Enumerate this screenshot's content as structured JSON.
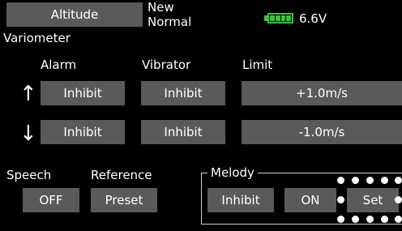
{
  "header": {
    "title": "Altitude",
    "mode_line1": "New",
    "mode_line2": "Normal",
    "battery_voltage": "6.6V",
    "battery_icon": "battery-full-icon",
    "battery_color": "#3fbf3f"
  },
  "section": {
    "title": "Variometer"
  },
  "columns": {
    "alarm": "Alarm",
    "vibrator": "Vibrator",
    "limit": "Limit"
  },
  "up_row": {
    "arrow": "↑",
    "alarm": "Inhibit",
    "vibrator": "Inhibit",
    "limit": "+1.0m/s"
  },
  "down_row": {
    "arrow": "↓",
    "alarm": "Inhibit",
    "vibrator": "Inhibit",
    "limit": "-1.0m/s"
  },
  "speech": {
    "label": "Speech",
    "value": "OFF"
  },
  "reference": {
    "label": "Reference",
    "value": "Preset"
  },
  "melody": {
    "label": "Melody",
    "mode": "Inhibit",
    "state": "ON",
    "action": "Set"
  },
  "colors": {
    "button": "#5a5a5a",
    "background": "#000000",
    "selection_dots": "#ffffff"
  }
}
